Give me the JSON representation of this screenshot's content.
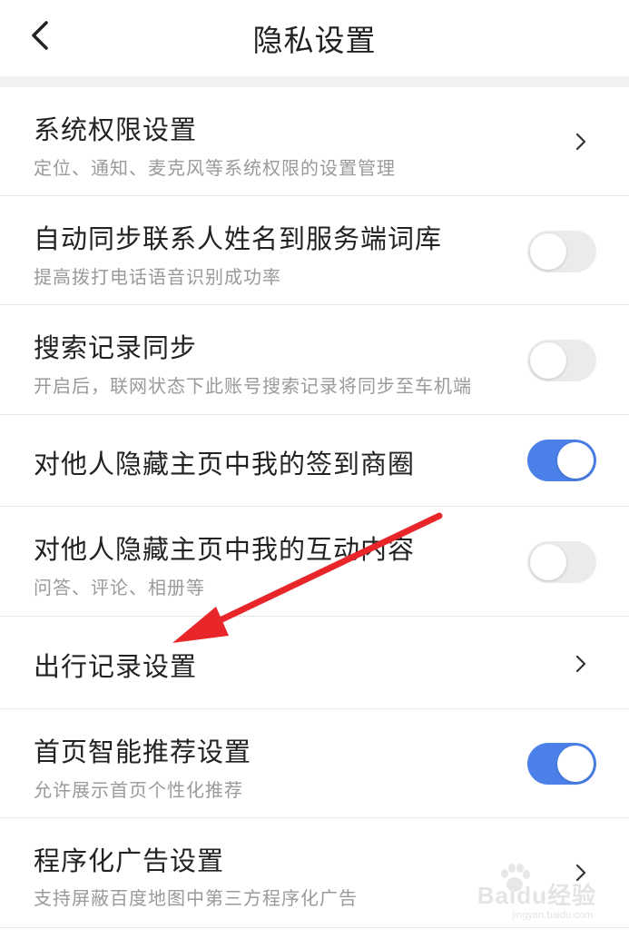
{
  "header": {
    "title": "隐私设置",
    "back_icon": "chevron-left-icon"
  },
  "rows": [
    {
      "title": "系统权限设置",
      "subtitle": "定位、通知、麦克风等系统权限的设置管理",
      "control": "chevron"
    },
    {
      "title": "自动同步联系人姓名到服务端词库",
      "subtitle": "提高拨打电话语音识别成功率",
      "control": "toggle",
      "on": false
    },
    {
      "title": "搜索记录同步",
      "subtitle": "开启后，联网状态下此账号搜索记录将同步至车机端",
      "control": "toggle",
      "on": false
    },
    {
      "title": "对他人隐藏主页中我的签到商圈",
      "subtitle": "",
      "control": "toggle",
      "on": true
    },
    {
      "title": "对他人隐藏主页中我的互动内容",
      "subtitle": "问答、评论、相册等",
      "control": "toggle",
      "on": false
    },
    {
      "title": "出行记录设置",
      "subtitle": "",
      "control": "chevron"
    },
    {
      "title": "首页智能推荐设置",
      "subtitle": "允许展示首页个性化推荐",
      "control": "toggle",
      "on": true
    },
    {
      "title": "程序化广告设置",
      "subtitle": "支持屏蔽百度地图中第三方程序化广告",
      "control": "chevron"
    }
  ],
  "colors": {
    "toggle_on": "#4a80e8",
    "toggle_off": "#ebebeb",
    "annotation_arrow": "#e8262a"
  },
  "watermark": {
    "text": "Baidu经验",
    "url": "jingyan.baidu.com"
  }
}
